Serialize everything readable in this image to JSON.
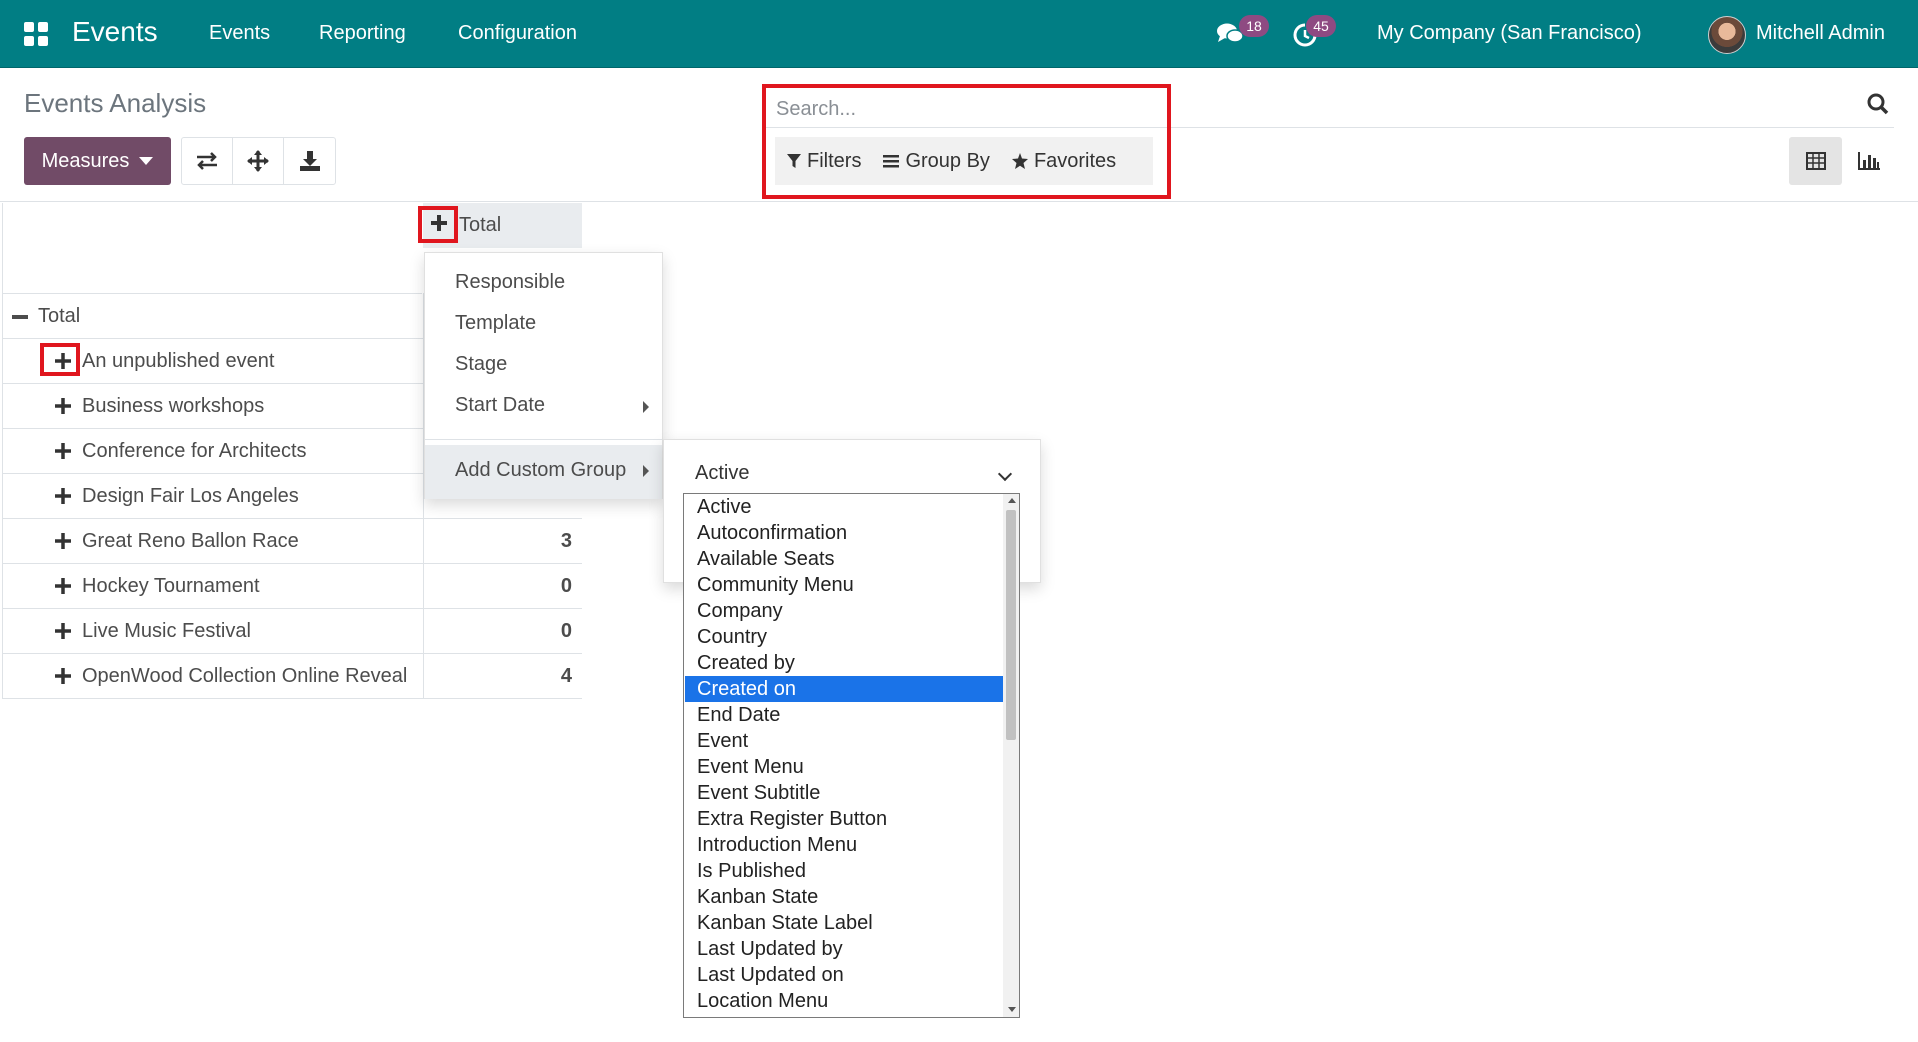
{
  "app": {
    "name": "Events"
  },
  "nav": {
    "items": [
      "Events",
      "Reporting",
      "Configuration"
    ]
  },
  "systray": {
    "messages_count": "18",
    "activities_count": "45",
    "company": "My Company (San Francisco)",
    "user": "Mitchell Admin"
  },
  "control_panel": {
    "title": "Events Analysis",
    "measures_label": "Measures",
    "search_placeholder": "Search...",
    "filters_label": "Filters",
    "groupby_label": "Group By",
    "favorites_label": "Favorites"
  },
  "pivot": {
    "header_total": "Total",
    "row_total": "Total",
    "rows": [
      {
        "label": "An unpublished event",
        "value": ""
      },
      {
        "label": "Business workshops",
        "value": ""
      },
      {
        "label": "Conference for Architects",
        "value": ""
      },
      {
        "label": "Design Fair Los Angeles",
        "value": ""
      },
      {
        "label": "Great Reno Ballon Race",
        "value": "3"
      },
      {
        "label": "Hockey Tournament",
        "value": "0"
      },
      {
        "label": "Live Music Festival",
        "value": "0"
      },
      {
        "label": "OpenWood Collection Online Reveal",
        "value": "4"
      }
    ]
  },
  "groupby_menu": {
    "items": [
      "Responsible",
      "Template",
      "Stage",
      "Start Date"
    ],
    "custom_group_label": "Add Custom Group",
    "selected_field": "Active",
    "options": [
      "Active",
      "Autoconfirmation",
      "Available Seats",
      "Community Menu",
      "Company",
      "Country",
      "Created by",
      "Created on",
      "End Date",
      "Event",
      "Event Menu",
      "Event Subtitle",
      "Extra Register Button",
      "Introduction Menu",
      "Is Published",
      "Kanban State",
      "Kanban State Label",
      "Last Updated by",
      "Last Updated on",
      "Location Menu"
    ],
    "highlighted_option": "Created on"
  },
  "colors": {
    "navbar": "#017e84",
    "primary": "#714b67",
    "badge": "#8e4a82",
    "annotation": "#e0161e",
    "highlight": "#1a73e8"
  }
}
